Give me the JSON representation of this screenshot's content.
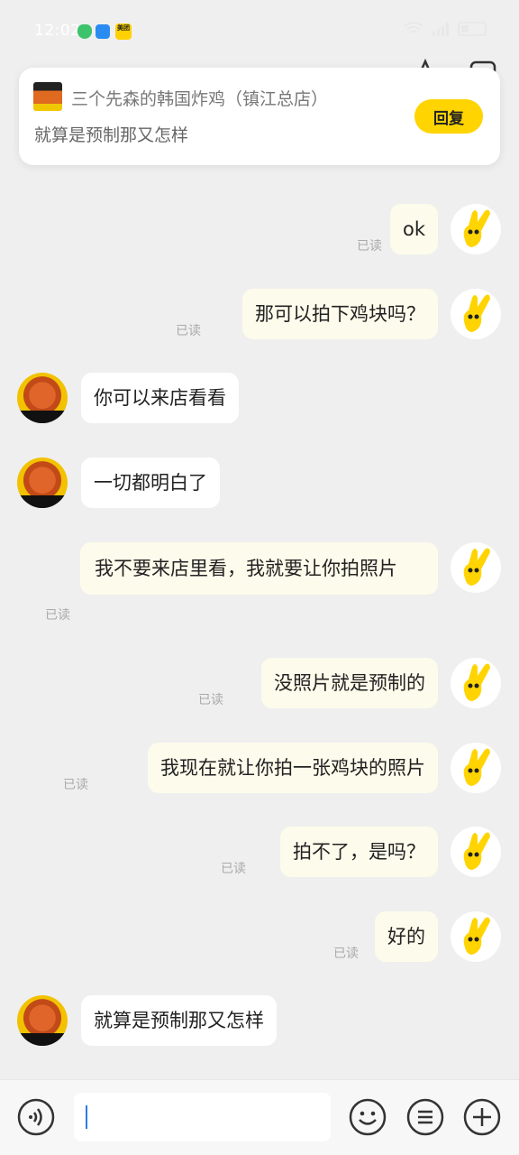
{
  "status_bar": {
    "time": "12:02",
    "meituan_label": "美团"
  },
  "notification": {
    "title": "三个先森的韩国炸鸡（镇江总店）",
    "body": "就算是预制那又怎样",
    "reply_label": "回复"
  },
  "read_label": "已读",
  "messages": [
    {
      "side": "right",
      "text": "ok",
      "read": "已读"
    },
    {
      "side": "right",
      "text": "那可以拍下鸡块吗？",
      "read": "已读"
    },
    {
      "side": "left",
      "text": "你可以来店看看"
    },
    {
      "side": "left",
      "text": "一切都明白了"
    },
    {
      "side": "right",
      "text": " 我不要来店里看，我就要让你拍照片",
      "read": "已读"
    },
    {
      "side": "right",
      "text": "没照片就是预制的",
      "read": "已读"
    },
    {
      "side": "right",
      "text": "我现在就让你拍一张鸡块的照片",
      "read": "已读"
    },
    {
      "side": "right",
      "text": "拍不了，是吗？",
      "read": "已读"
    },
    {
      "side": "right",
      "text": "好的",
      "read": "已读"
    },
    {
      "side": "left",
      "text": "就算是预制那又怎样"
    }
  ],
  "input": {
    "value": "",
    "placeholder": ""
  },
  "icons": {
    "voice": "voice-icon",
    "emoji": "emoji-icon",
    "menu": "menu-list-icon",
    "add": "plus-icon",
    "user_avatar": "yellow-hand-avatar",
    "shop_avatar": "fried-chicken-avatar"
  },
  "colors": {
    "accent": "#ffd400",
    "outgoing_bubble": "#fdfbeb",
    "incoming_bubble": "#ffffff",
    "background": "#efefef"
  }
}
